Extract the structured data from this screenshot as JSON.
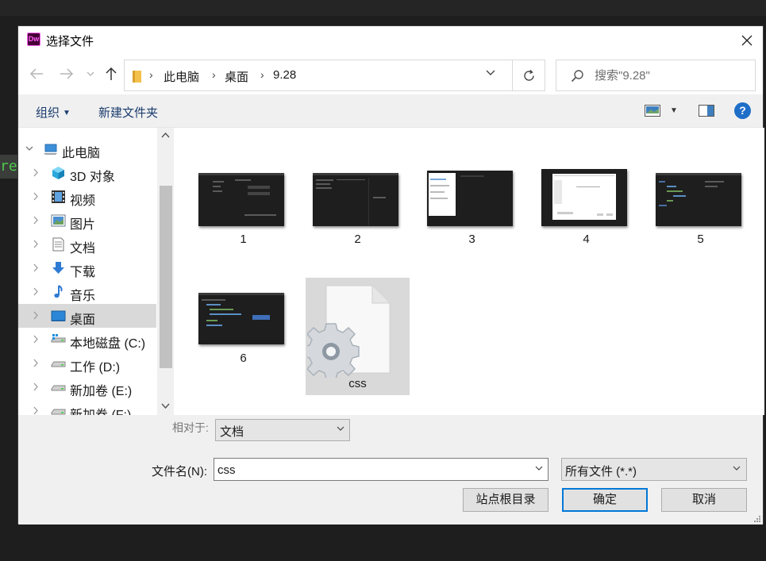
{
  "background": {
    "code_fragment": "re"
  },
  "dialog": {
    "app_icon_text": "Dw",
    "title": "选择文件"
  },
  "address_bar": {
    "path": [
      "此电脑",
      "桌面",
      "9.28"
    ]
  },
  "search": {
    "placeholder": "搜索\"9.28\""
  },
  "toolbar": {
    "organize_label": "组织",
    "new_folder_label": "新建文件夹",
    "help_label": "?"
  },
  "sidebar": {
    "items": [
      {
        "label": "此电脑",
        "icon": "computer-icon"
      },
      {
        "label": "3D 对象",
        "icon": "3d-objects-icon"
      },
      {
        "label": "视频",
        "icon": "videos-icon"
      },
      {
        "label": "图片",
        "icon": "pictures-icon"
      },
      {
        "label": "文档",
        "icon": "documents-icon"
      },
      {
        "label": "下载",
        "icon": "downloads-icon"
      },
      {
        "label": "音乐",
        "icon": "music-icon"
      },
      {
        "label": "桌面",
        "icon": "desktop-icon",
        "selected": true
      },
      {
        "label": "本地磁盘 (C:)",
        "icon": "drive-c-icon"
      },
      {
        "label": "工作 (D:)",
        "icon": "drive-icon"
      },
      {
        "label": "新加卷 (E:)",
        "icon": "drive-icon"
      },
      {
        "label": "新加卷 (F:)",
        "icon": "drive-icon"
      }
    ]
  },
  "files": [
    {
      "name": "1",
      "kind": "screenshot"
    },
    {
      "name": "2",
      "kind": "screenshot"
    },
    {
      "name": "3",
      "kind": "screenshot"
    },
    {
      "name": "4",
      "kind": "screenshot"
    },
    {
      "name": "5",
      "kind": "screenshot"
    },
    {
      "name": "6",
      "kind": "screenshot"
    },
    {
      "name": "css",
      "kind": "system-file",
      "selected": true
    }
  ],
  "bottom": {
    "relative_label": "相对于:",
    "relative_value": "文档",
    "filename_label": "文件名(N):",
    "filename_value": "css",
    "filetype_value": "所有文件 (*.*)",
    "site_root_label": "站点根目录",
    "ok_label": "确定",
    "cancel_label": "取消"
  },
  "colors": {
    "accent": "#0078d7",
    "dw_brand": "#ff61f6",
    "selection": "#d9d9d9"
  }
}
